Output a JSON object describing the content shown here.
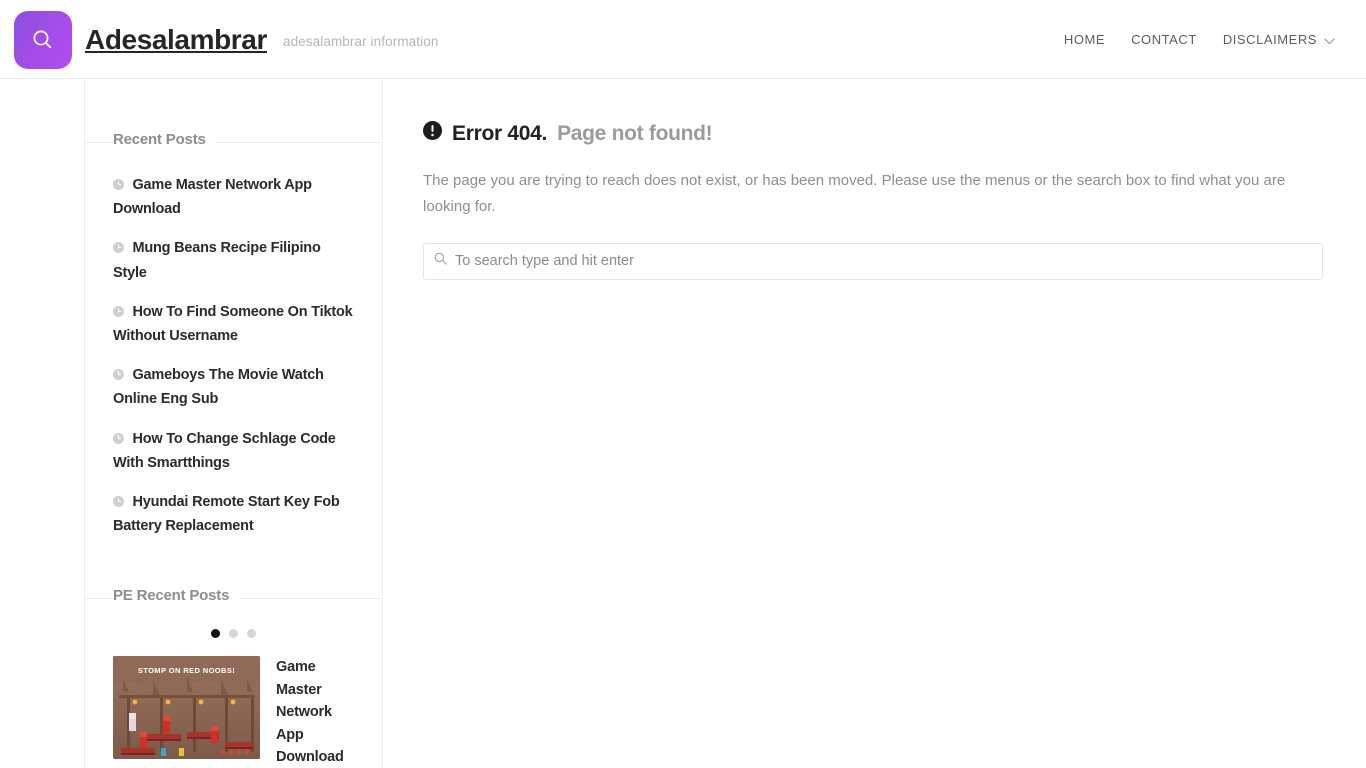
{
  "header": {
    "logo_icon": "search-icon",
    "logo_gradient_from": "#8b4ee0",
    "logo_gradient_to": "#b44cf0",
    "site_title": "Adesalambrar",
    "tagline": "adesalambrar information",
    "nav": [
      {
        "label": "HOME",
        "has_dropdown": false
      },
      {
        "label": "CONTACT",
        "has_dropdown": false
      },
      {
        "label": "DISCLAIMERS",
        "has_dropdown": true
      }
    ]
  },
  "sidebar": {
    "recent_posts": {
      "title": "Recent Posts",
      "item_icon": "clock-icon",
      "items": [
        {
          "title": "Game Master Network App Download"
        },
        {
          "title": "Mung Beans Recipe Filipino Style"
        },
        {
          "title": "How To Find Someone On Tiktok Without Username"
        },
        {
          "title": "Gameboys The Movie Watch Online Eng Sub"
        },
        {
          "title": "How To Change Schlage Code With Smartthings"
        },
        {
          "title": "Hyundai Remote Start Key Fob Battery Replacement"
        }
      ]
    },
    "pe_recent_posts": {
      "title": "PE Recent Posts",
      "dots": [
        {
          "active": true
        },
        {
          "active": false
        },
        {
          "active": false
        }
      ],
      "slide": {
        "thumbnail_alt": "STOMP ON RED NOOBS!",
        "thumbnail_caption": "STOMP ON RED NOOBS!",
        "title": "Game Master Network App Download"
      }
    }
  },
  "main": {
    "error_icon": "alert-circle-icon",
    "error_code": "Error 404.",
    "error_subtitle": "Page not found!",
    "error_description": "The page you are trying to reach does not exist, or has been moved. Please use the menus or the search box to find what you are looking for.",
    "search": {
      "icon": "search-icon",
      "placeholder": "To search type and hit enter",
      "value": ""
    }
  },
  "colors": {
    "accent": "#a14de8",
    "text_dark": "#2b2b2b",
    "text_muted": "#8e8e8e",
    "border": "#eeeeee"
  }
}
